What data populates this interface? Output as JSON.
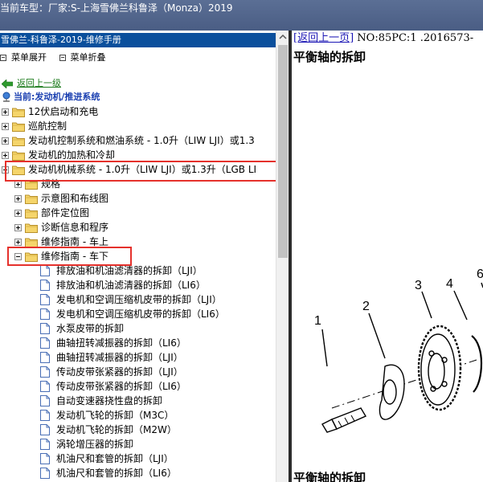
{
  "titlebar": {
    "text": "当前车型：厂家:S-上海雪佛兰科鲁泽（Monza）2019"
  },
  "manual": {
    "title": "雪佛兰-科鲁泽-2019-维修手册",
    "toolbar": {
      "expand": "菜单展开",
      "collapse": "菜单折叠"
    },
    "back": "返回上一级",
    "current": "当前:发动机/推进系统"
  },
  "tree": {
    "top": [
      "12伏启动和充电",
      "巡航控制",
      "发动机控制系统和燃油系统 - 1.0升（LIW LJI）或1.3",
      "发动机的加热和冷却",
      "发动机机械系统 - 1.0升（LIW LJI）或1.3升（LGB LI"
    ],
    "sub": [
      "规格",
      "示意图和布线图",
      "部件定位图",
      "诊断信息和程序",
      "维修指南 - 车上",
      "维修指南 - 车下"
    ],
    "docs": [
      "排放油和机油滤清器的拆卸（LJI）",
      "排放油和机油滤清器的拆卸（LI6）",
      "发电机和空调压缩机皮带的拆卸（LJI）",
      "发电机和空调压缩机皮带的拆卸（LI6）",
      "水泵皮带的拆卸",
      "曲轴扭转减振器的拆卸（LI6）",
      "曲轴扭转减振器的拆卸（LJI）",
      "传动皮带张紧器的拆卸（LJI）",
      "传动皮带张紧器的拆卸（LI6）",
      "自动变速器挠性盘的拆卸",
      "发动机飞轮的拆卸（M3C）",
      "发动机飞轮的拆卸（M2W）",
      "涡轮增压器的拆卸",
      "机油尺和套管的拆卸（LJI）",
      "机油尺和套管的拆卸（LI6）"
    ]
  },
  "content": {
    "nav_link": "[返回上一页]",
    "nav_rest": " NO:85PC:1 .2016573-",
    "heading": "平衡轴的拆卸",
    "heading2": "平衡轴的拆卸",
    "callouts": [
      "1",
      "2",
      "3",
      "4",
      "6"
    ]
  },
  "colors": {
    "highlight": "#e5312c",
    "header": "#0a4f9c",
    "link": "#1b16b5"
  },
  "icons": [
    "folder-icon",
    "document-icon",
    "back-arrow-icon",
    "location-pin-icon"
  ]
}
